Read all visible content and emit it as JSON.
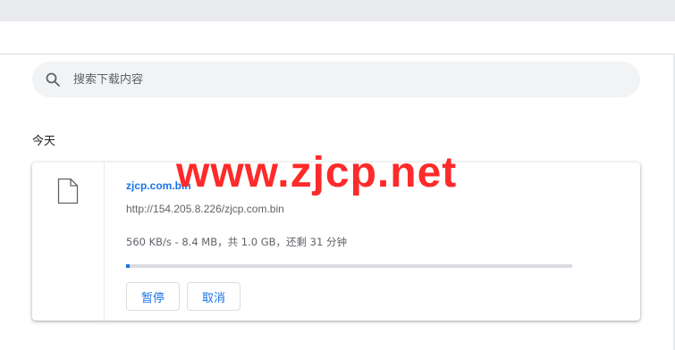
{
  "search": {
    "placeholder": "搜索下载内容",
    "icon": "search-icon"
  },
  "section": {
    "title": "今天"
  },
  "download": {
    "file_icon": "file-icon",
    "file_name": "zjcp.com.bin",
    "url": "http://154.205.8.226/zjcp.com.bin",
    "progress_text": "560 KB/s - 8.4 MB，共 1.0 GB，还剩 31 分钟",
    "progress_fraction": 0.0084,
    "pause_label": "暂停",
    "cancel_label": "取消"
  },
  "watermark": {
    "text": "www.zjcp.net",
    "color": "#ff2a2a"
  },
  "colors": {
    "accent": "#1a73e8",
    "tab_strip": "#e8eaed",
    "search_bg": "#f1f3f4",
    "progress_track": "#dadce0"
  }
}
